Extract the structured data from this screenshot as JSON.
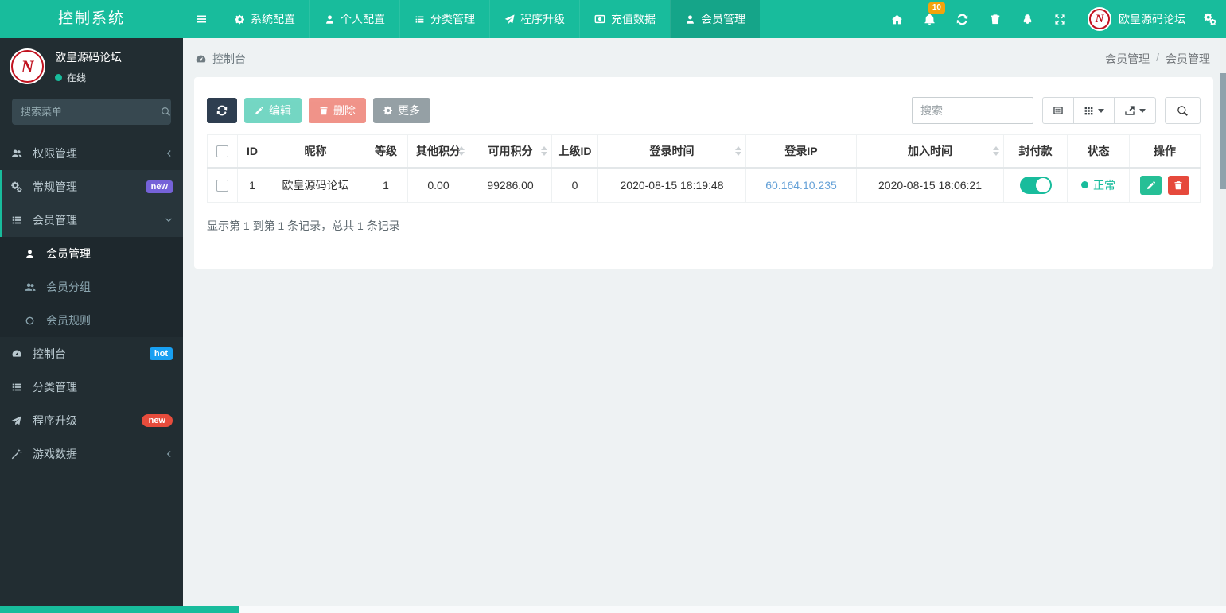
{
  "app": {
    "title": "控制系统"
  },
  "topnav": {
    "items": [
      {
        "label": "系统配置"
      },
      {
        "label": "个人配置"
      },
      {
        "label": "分类管理"
      },
      {
        "label": "程序升级"
      },
      {
        "label": "充值数据"
      },
      {
        "label": "会员管理"
      }
    ],
    "active_item": "会员管理",
    "notification_count": "10",
    "user_name": "欧皇源码论坛"
  },
  "sidebar": {
    "user": {
      "name": "欧皇源码论坛",
      "status": "在线"
    },
    "search_placeholder": "搜索菜单",
    "menu": [
      {
        "label": "权限管理"
      },
      {
        "label": "常规管理",
        "badge": "new"
      },
      {
        "label": "会员管理"
      },
      {
        "label": "控制台",
        "badge": "hot"
      },
      {
        "label": "分类管理"
      },
      {
        "label": "程序升级",
        "badge": "new"
      },
      {
        "label": "游戏数据"
      }
    ],
    "submenu": [
      {
        "label": "会员管理"
      },
      {
        "label": "会员分组"
      },
      {
        "label": "会员规则"
      }
    ]
  },
  "breadcrumb": {
    "left": "控制台",
    "parent": "会员管理",
    "separator": "/",
    "current": "会员管理"
  },
  "toolbar": {
    "edit_label": "编辑",
    "delete_label": "删除",
    "more_label": "更多",
    "search_placeholder": "搜索"
  },
  "table": {
    "headers": {
      "id": "ID",
      "nickname": "昵称",
      "level": "等级",
      "other_points": "其他积分",
      "available_points": "可用积分",
      "parent_id": "上级ID",
      "login_time": "登录时间",
      "login_ip": "登录IP",
      "join_time": "加入时间",
      "block_payment": "封付款",
      "status": "状态",
      "actions": "操作"
    },
    "row": {
      "id": "1",
      "nickname": "欧皇源码论坛",
      "level": "1",
      "other_points": "0.00",
      "available_points": "99286.00",
      "parent_id": "0",
      "login_time": "2020-08-15 18:19:48",
      "login_ip": "60.164.10.235",
      "join_time": "2020-08-15 18:06:21",
      "block_payment_on": true,
      "status": "正常"
    },
    "summary": "显示第 1 到第 1 条记录，总共 1 条记录"
  },
  "colors": {
    "accent_teal": "#18bc9c",
    "navbar_active": "#15a589",
    "sidebar_bg": "#222d32",
    "badge_purple": "#7562d8",
    "badge_blue": "#18a0f2",
    "badge_red": "#e74c3c",
    "notification_badge": "#f3a30c",
    "button_dark": "#2e3e50",
    "button_gray": "#95a0a5",
    "link_blue": "#65a1d7",
    "status_green": "#18bc9c"
  },
  "icons": {
    "menu-icon": "three-bars",
    "gear-icon": "cog",
    "gears-icon": "double-cog",
    "user-icon": "person",
    "users-icon": "people",
    "list-icon": "list-lines",
    "rocket-icon": "paper-plane",
    "recharge-icon": "coin-card",
    "home-icon": "house",
    "bell-icon": "bell",
    "refresh-icon": "circular-arrows",
    "trash-icon": "trash-can",
    "qq-icon": "penguin",
    "fullscreen-icon": "four-diagonal-arrows",
    "search-icon": "magnifier",
    "dashboard-icon": "gauge",
    "wand-icon": "magic-wand",
    "circle-icon": "circle-outline",
    "edit-icon": "pencil",
    "delete-icon": "trash-can",
    "detail-view-icon": "framed-list",
    "columns-icon": "grid-squares",
    "export-icon": "arrow-out-of-tray",
    "caret-down-icon": "small-triangle",
    "chevron-left-icon": "angle-left",
    "chevron-down-icon": "angle-down"
  }
}
